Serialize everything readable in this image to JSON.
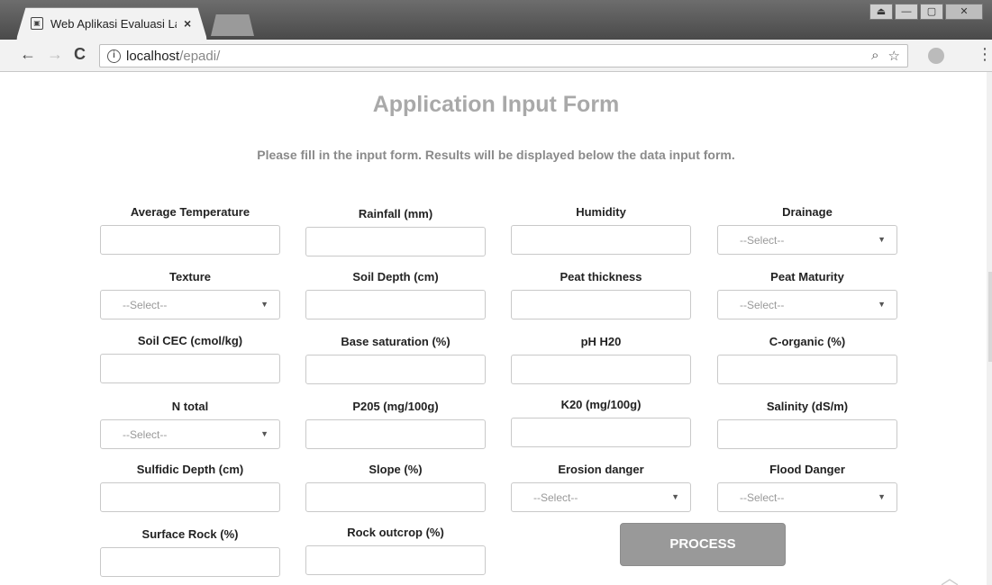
{
  "browser": {
    "tab_title": "Web Aplikasi Evaluasi La",
    "tab_close": "×",
    "url_host": "localhost",
    "url_path": "/epadi/",
    "back": "←",
    "forward": "→",
    "reload": "C",
    "zoom_icon": "⌕",
    "star_icon": "☆",
    "menu_icon": "⋮"
  },
  "page": {
    "title": "Application Input Form",
    "subtitle": "Please fill in the input form. Results will be displayed below the data input form."
  },
  "fields": {
    "avg_temp": {
      "label": "Average Temperature"
    },
    "rainfall": {
      "label": "Rainfall (mm)"
    },
    "humidity": {
      "label": "Humidity"
    },
    "drainage": {
      "label": "Drainage",
      "selected": "--Select--"
    },
    "texture": {
      "label": "Texture",
      "selected": "--Select--"
    },
    "soil_depth": {
      "label": "Soil Depth (cm)"
    },
    "peat_thickness": {
      "label": "Peat thickness"
    },
    "peat_maturity": {
      "label": "Peat Maturity",
      "selected": "--Select--"
    },
    "soil_cec": {
      "label": "Soil CEC (cmol/kg)"
    },
    "base_saturation": {
      "label": "Base saturation (%)"
    },
    "ph_h20": {
      "label": "pH H20"
    },
    "c_organic": {
      "label": "C-organic (%)"
    },
    "n_total": {
      "label": "N total",
      "selected": "--Select--"
    },
    "p205": {
      "label": "P205 (mg/100g)"
    },
    "k20": {
      "label": "K20 (mg/100g)"
    },
    "salinity": {
      "label": "Salinity (dS/m)"
    },
    "sulfidic_depth": {
      "label": "Sulfidic Depth (cm)"
    },
    "slope": {
      "label": "Slope (%)"
    },
    "erosion_danger": {
      "label": "Erosion danger",
      "selected": "--Select--"
    },
    "flood_danger": {
      "label": "Flood Danger",
      "selected": "--Select--"
    },
    "surface_rock": {
      "label": "Surface Rock (%)"
    },
    "rock_outcrop": {
      "label": "Rock outcrop (%)"
    }
  },
  "process_button": "PROCESS"
}
